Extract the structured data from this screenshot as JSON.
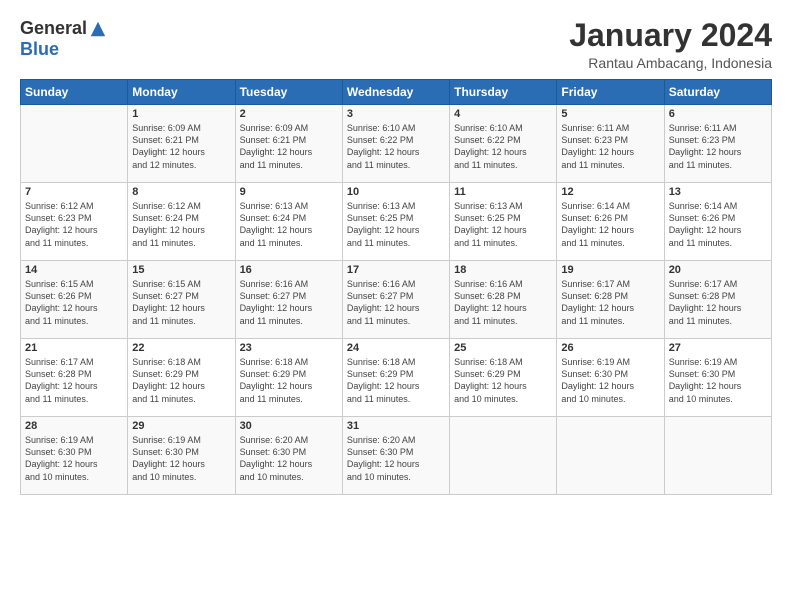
{
  "header": {
    "logo_general": "General",
    "logo_blue": "Blue",
    "month_title": "January 2024",
    "subtitle": "Rantau Ambacang, Indonesia"
  },
  "weekdays": [
    "Sunday",
    "Monday",
    "Tuesday",
    "Wednesday",
    "Thursday",
    "Friday",
    "Saturday"
  ],
  "weeks": [
    [
      {
        "day": "",
        "info": ""
      },
      {
        "day": "1",
        "info": "Sunrise: 6:09 AM\nSunset: 6:21 PM\nDaylight: 12 hours\nand 12 minutes."
      },
      {
        "day": "2",
        "info": "Sunrise: 6:09 AM\nSunset: 6:21 PM\nDaylight: 12 hours\nand 11 minutes."
      },
      {
        "day": "3",
        "info": "Sunrise: 6:10 AM\nSunset: 6:22 PM\nDaylight: 12 hours\nand 11 minutes."
      },
      {
        "day": "4",
        "info": "Sunrise: 6:10 AM\nSunset: 6:22 PM\nDaylight: 12 hours\nand 11 minutes."
      },
      {
        "day": "5",
        "info": "Sunrise: 6:11 AM\nSunset: 6:23 PM\nDaylight: 12 hours\nand 11 minutes."
      },
      {
        "day": "6",
        "info": "Sunrise: 6:11 AM\nSunset: 6:23 PM\nDaylight: 12 hours\nand 11 minutes."
      }
    ],
    [
      {
        "day": "7",
        "info": ""
      },
      {
        "day": "8",
        "info": "Sunrise: 6:12 AM\nSunset: 6:24 PM\nDaylight: 12 hours\nand 11 minutes."
      },
      {
        "day": "9",
        "info": "Sunrise: 6:13 AM\nSunset: 6:24 PM\nDaylight: 12 hours\nand 11 minutes."
      },
      {
        "day": "10",
        "info": "Sunrise: 6:13 AM\nSunset: 6:25 PM\nDaylight: 12 hours\nand 11 minutes."
      },
      {
        "day": "11",
        "info": "Sunrise: 6:13 AM\nSunset: 6:25 PM\nDaylight: 12 hours\nand 11 minutes."
      },
      {
        "day": "12",
        "info": "Sunrise: 6:14 AM\nSunset: 6:26 PM\nDaylight: 12 hours\nand 11 minutes."
      },
      {
        "day": "13",
        "info": "Sunrise: 6:14 AM\nSunset: 6:26 PM\nDaylight: 12 hours\nand 11 minutes."
      }
    ],
    [
      {
        "day": "14",
        "info": ""
      },
      {
        "day": "15",
        "info": "Sunrise: 6:15 AM\nSunset: 6:27 PM\nDaylight: 12 hours\nand 11 minutes."
      },
      {
        "day": "16",
        "info": "Sunrise: 6:16 AM\nSunset: 6:27 PM\nDaylight: 12 hours\nand 11 minutes."
      },
      {
        "day": "17",
        "info": "Sunrise: 6:16 AM\nSunset: 6:27 PM\nDaylight: 12 hours\nand 11 minutes."
      },
      {
        "day": "18",
        "info": "Sunrise: 6:16 AM\nSunset: 6:28 PM\nDaylight: 12 hours\nand 11 minutes."
      },
      {
        "day": "19",
        "info": "Sunrise: 6:17 AM\nSunset: 6:28 PM\nDaylight: 12 hours\nand 11 minutes."
      },
      {
        "day": "20",
        "info": "Sunrise: 6:17 AM\nSunset: 6:28 PM\nDaylight: 12 hours\nand 11 minutes."
      }
    ],
    [
      {
        "day": "21",
        "info": ""
      },
      {
        "day": "22",
        "info": "Sunrise: 6:18 AM\nSunset: 6:29 PM\nDaylight: 12 hours\nand 11 minutes."
      },
      {
        "day": "23",
        "info": "Sunrise: 6:18 AM\nSunset: 6:29 PM\nDaylight: 12 hours\nand 11 minutes."
      },
      {
        "day": "24",
        "info": "Sunrise: 6:18 AM\nSunset: 6:29 PM\nDaylight: 12 hours\nand 11 minutes."
      },
      {
        "day": "25",
        "info": "Sunrise: 6:18 AM\nSunset: 6:29 PM\nDaylight: 12 hours\nand 10 minutes."
      },
      {
        "day": "26",
        "info": "Sunrise: 6:19 AM\nSunset: 6:30 PM\nDaylight: 12 hours\nand 10 minutes."
      },
      {
        "day": "27",
        "info": "Sunrise: 6:19 AM\nSunset: 6:30 PM\nDaylight: 12 hours\nand 10 minutes."
      }
    ],
    [
      {
        "day": "28",
        "info": "Sunrise: 6:19 AM\nSunset: 6:30 PM\nDaylight: 12 hours\nand 10 minutes."
      },
      {
        "day": "29",
        "info": "Sunrise: 6:19 AM\nSunset: 6:30 PM\nDaylight: 12 hours\nand 10 minutes."
      },
      {
        "day": "30",
        "info": "Sunrise: 6:20 AM\nSunset: 6:30 PM\nDaylight: 12 hours\nand 10 minutes."
      },
      {
        "day": "31",
        "info": "Sunrise: 6:20 AM\nSunset: 6:30 PM\nDaylight: 12 hours\nand 10 minutes."
      },
      {
        "day": "",
        "info": ""
      },
      {
        "day": "",
        "info": ""
      },
      {
        "day": "",
        "info": ""
      }
    ]
  ],
  "week1_day7_info": "Sunrise: 6:12 AM\nSunset: 6:23 PM\nDaylight: 12 hours\nand 11 minutes.",
  "week2_day14_info": "Sunrise: 6:15 AM\nSunset: 6:26 PM\nDaylight: 12 hours\nand 11 minutes.",
  "week3_day21_info": "Sunrise: 6:17 AM\nSunset: 6:28 PM\nDaylight: 12 hours\nand 11 minutes."
}
